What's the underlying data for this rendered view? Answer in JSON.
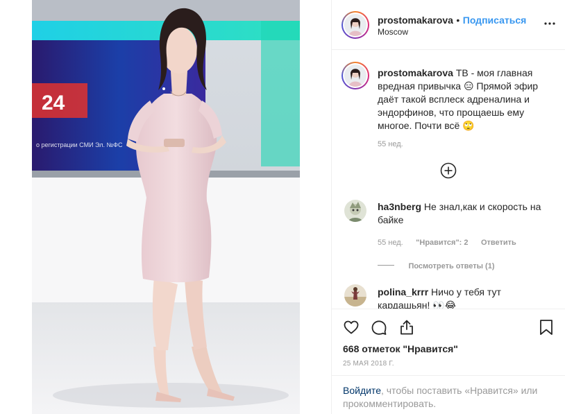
{
  "post": {
    "username": "prostomakarova",
    "separator": "•",
    "follow_label": "Подписаться",
    "location": "Moscow"
  },
  "caption": {
    "username": "prostomakarova",
    "text": "ТВ - моя главная вредная привычка 😑 Прямой эфир даёт такой всплеск адреналина и эндорфинов, что прощаешь ему многое. Почти всё 🙄",
    "time": "55 нед."
  },
  "comments": [
    {
      "username": "ha3nberg",
      "text": "Не знал,как и скорость на байке",
      "time": "55 нед.",
      "likes": "\"Нравится\": 2",
      "reply_label": "Ответить",
      "view_replies": "Посмотреть ответы (1)"
    },
    {
      "username": "polina_krrr",
      "text": "Ничо у тебя тут кардашьян! 👀😂"
    }
  ],
  "photo": {
    "screen_text": "24",
    "ticker": "о регистрации СМИ Эл. №ФС"
  },
  "stats": {
    "likes": "668 отметок \"Нравится\"",
    "date": "25 МАЯ 2018 Г."
  },
  "login": {
    "link": "Войдите",
    "rest": ", чтобы поставить «Нравится» или прокомментировать."
  },
  "icons": {
    "more": "more-horizontal-icon",
    "add": "add-circle-icon",
    "like": "heart-icon",
    "comment": "comment-icon",
    "share": "share-icon",
    "save": "bookmark-icon"
  }
}
